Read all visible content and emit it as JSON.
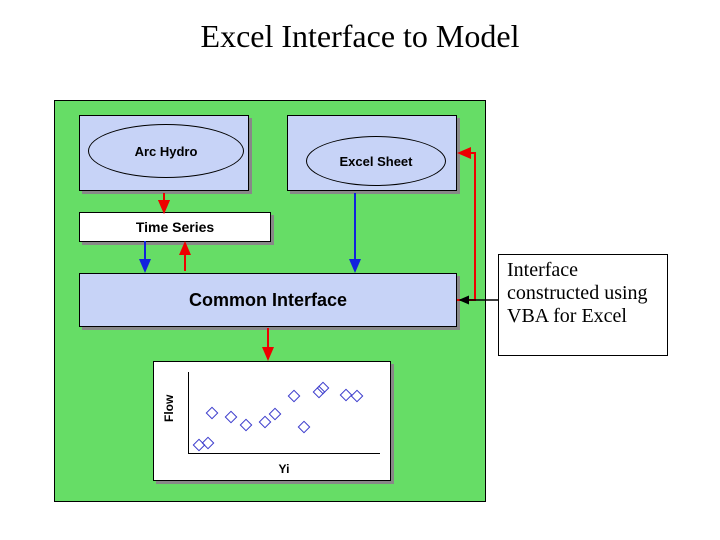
{
  "title": "Excel Interface to Model",
  "boxes": {
    "arc_hydro": "Arc Hydro",
    "excel_sheet": "Excel Sheet",
    "time_series": "Time Series",
    "common_interface": "Common Interface"
  },
  "callout": "Interface constructed using VBA for Excel",
  "chart_data": {
    "type": "scatter",
    "xlabel": "Yi",
    "ylabel": "Flow",
    "series": [
      {
        "name": "points",
        "x": [
          5,
          10,
          12,
          22,
          30,
          40,
          45,
          55,
          60,
          68,
          70,
          82,
          88
        ],
        "y": [
          10,
          12,
          50,
          45,
          35,
          38,
          48,
          70,
          32,
          75,
          80,
          72,
          70
        ]
      }
    ],
    "xlim": [
      0,
      100
    ],
    "ylim": [
      0,
      100
    ]
  }
}
